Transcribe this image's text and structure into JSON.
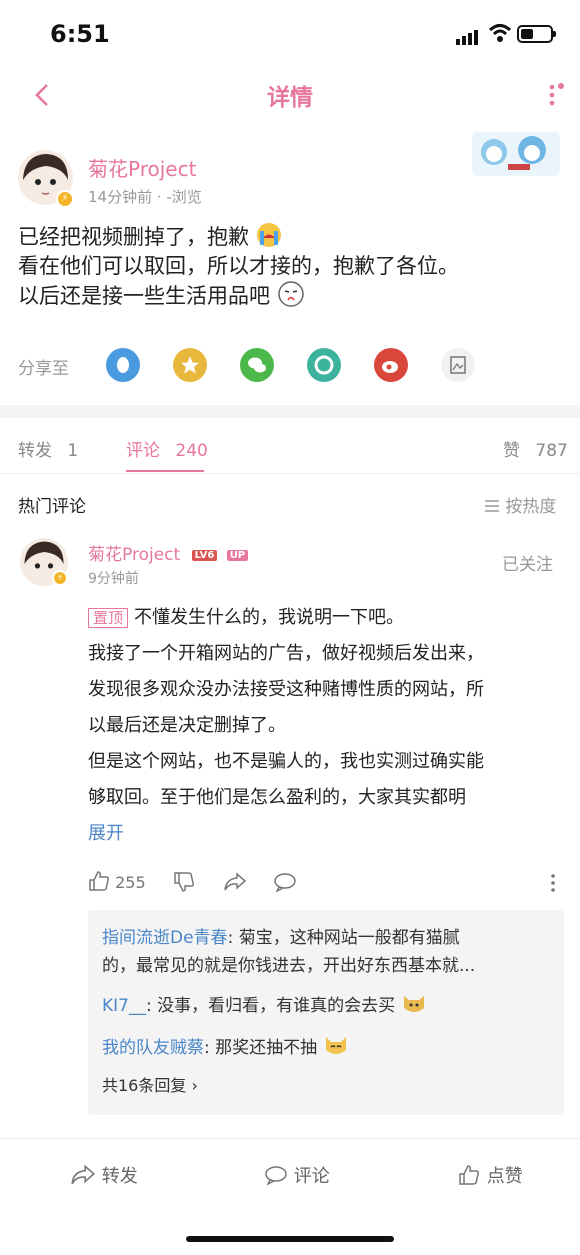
{
  "status": {
    "time": "6:51"
  },
  "nav": {
    "title": "详情"
  },
  "post": {
    "author": "菊花Project",
    "meta": "14分钟前 · -浏览",
    "lines": [
      "已经把视频删掉了，抱歉",
      "看在他们可以取回，所以才接的，抱歉了各位。",
      "以后还是接一些生活用品吧"
    ],
    "share_label": "分享至"
  },
  "tabs": {
    "repost_label": "转发",
    "repost_count": "1",
    "comment_label": "评论",
    "comment_count": "240",
    "like_label": "赞",
    "like_count": "787"
  },
  "hot": {
    "title": "热门评论",
    "sort_label": "按热度"
  },
  "comment": {
    "author": "菊花Project",
    "level_badge": "LV6",
    "up_badge": "UP",
    "time": "9分钟前",
    "follow_label": "已关注",
    "pin_tag": "置顶",
    "text": [
      "不懂发生什么的，我说明一下吧。",
      "我接了一个开箱网站的广告，做好视频后发出来，",
      "发现很多观众没办法接受这种赌博性质的网站，所",
      "以最后还是决定删掉了。",
      "但是这个网站，也不是骗人的，我也实测过确实能",
      "够取回。至于他们是怎么盈利的，大家其实都明"
    ],
    "expand_label": "展开",
    "like_count": "255"
  },
  "replies": [
    {
      "user": "指间流逝De青春",
      "text": "菊宝，这种网站一般都有猫腻",
      "text2": "的，最常见的就是你钱进去，开出好东西基本就..."
    },
    {
      "user": "KI7__",
      "text": "没事，看归看，有谁真的会去买"
    },
    {
      "user": "我的队友贼蔡",
      "text": "那奖还抽不抽"
    }
  ],
  "replies_more": "共16条回复 ›",
  "bottom": {
    "repost": "转发",
    "comment": "评论",
    "like": "点赞"
  },
  "colors": {
    "accent": "#e8779c",
    "link": "#4a86c8"
  }
}
